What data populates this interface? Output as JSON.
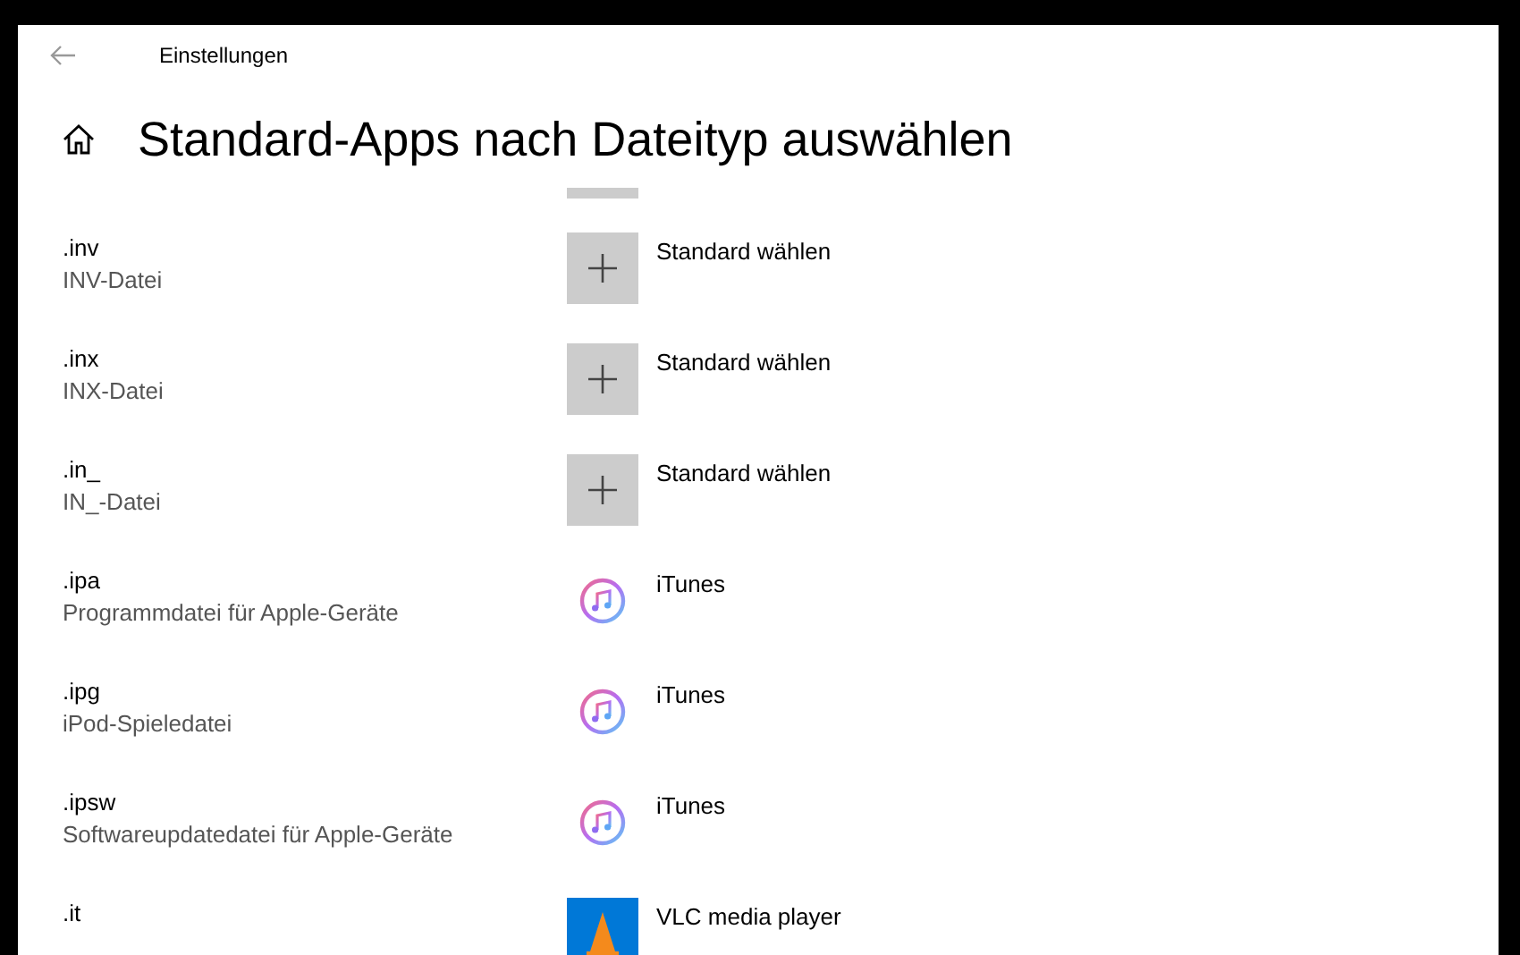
{
  "window": {
    "title": "Einstellungen"
  },
  "page": {
    "title": "Standard-Apps nach Dateityp auswählen"
  },
  "rows": [
    {
      "extension": ".inv",
      "description": "INV-Datei",
      "app": "Standard wählen",
      "kind": "add"
    },
    {
      "extension": ".inx",
      "description": "INX-Datei",
      "app": "Standard wählen",
      "kind": "add"
    },
    {
      "extension": ".in_",
      "description": "IN_-Datei",
      "app": "Standard wählen",
      "kind": "add"
    },
    {
      "extension": ".ipa",
      "description": "Programmdatei für Apple-Geräte",
      "app": "iTunes",
      "kind": "itunes"
    },
    {
      "extension": ".ipg",
      "description": "iPod-Spieledatei",
      "app": "iTunes",
      "kind": "itunes"
    },
    {
      "extension": ".ipsw",
      "description": "Softwareupdatedatei für Apple-Geräte",
      "app": "iTunes",
      "kind": "itunes"
    },
    {
      "extension": ".it",
      "app": "VLC media player",
      "kind": "vlc"
    }
  ]
}
